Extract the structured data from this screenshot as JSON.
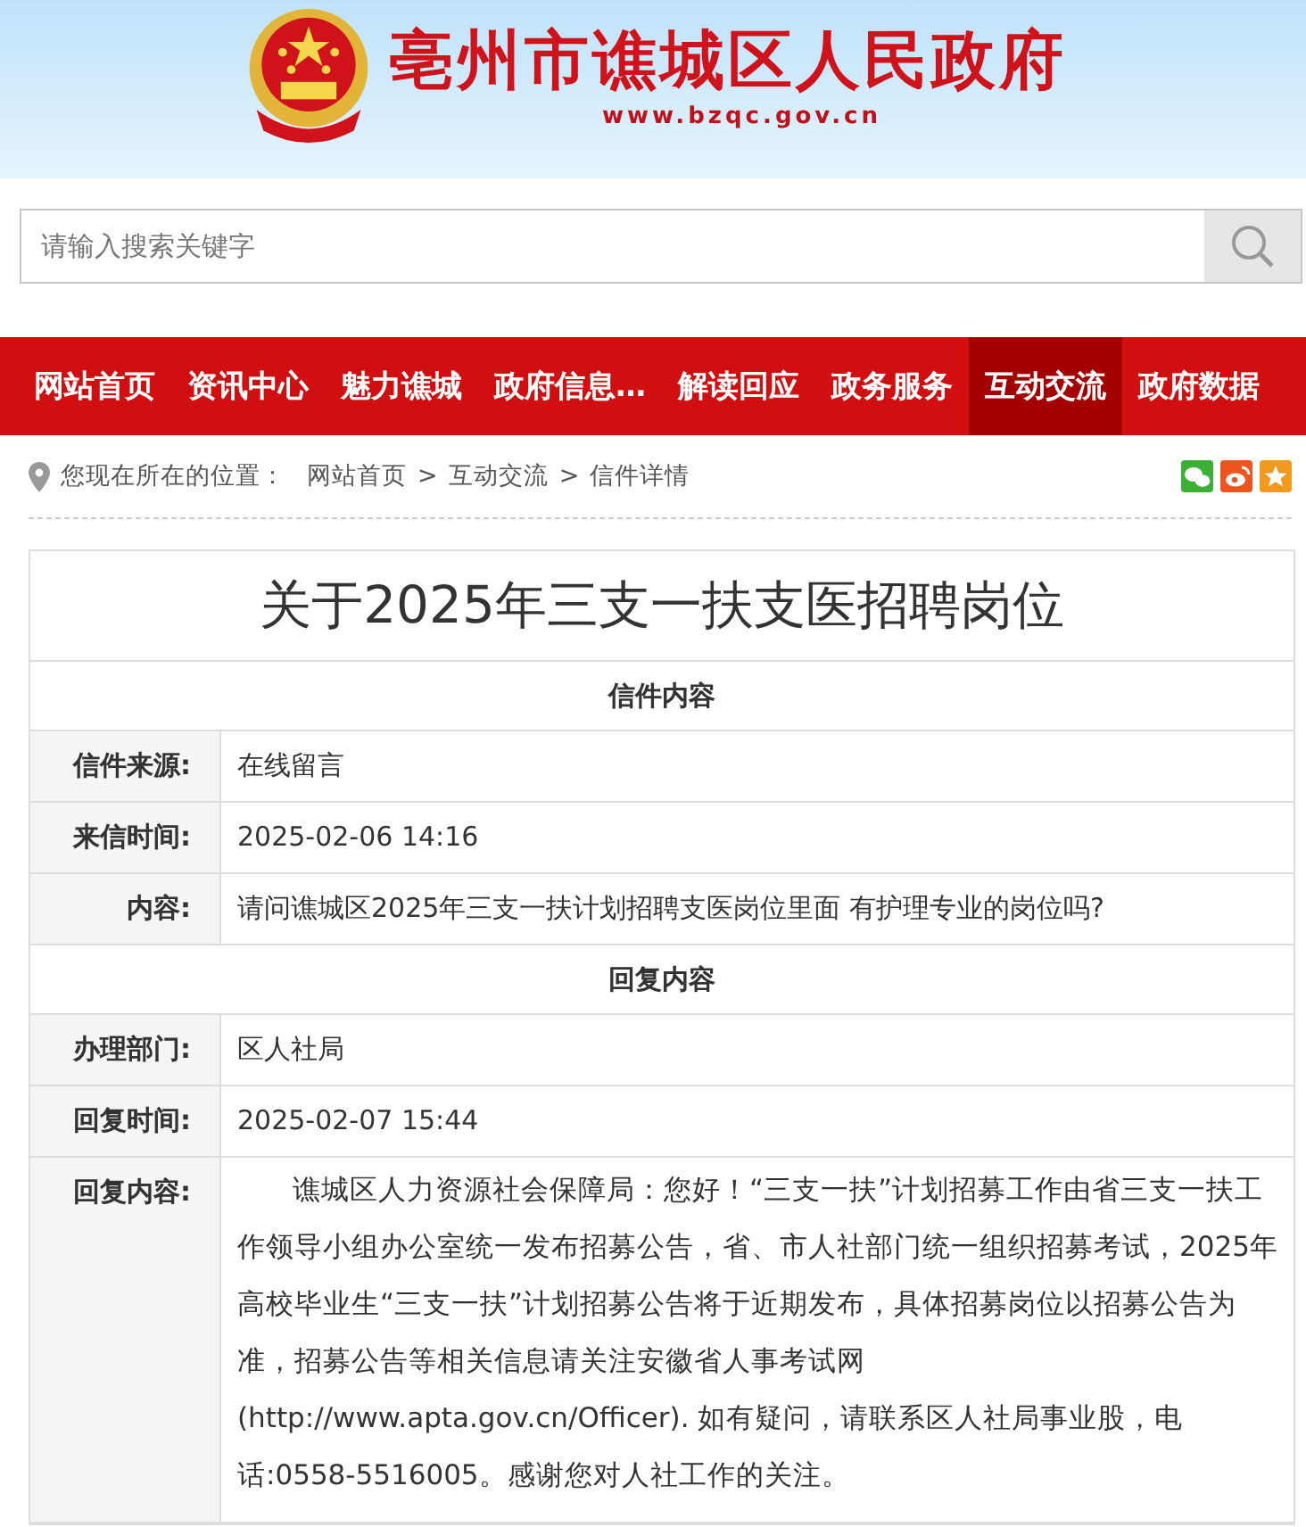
{
  "header": {
    "site_title": "亳州市谯城区人民政府",
    "site_url": "www.bzqc.gov.cn"
  },
  "search": {
    "placeholder": "请输入搜索关键字"
  },
  "nav": [
    {
      "label": "网站首页",
      "selected": false
    },
    {
      "label": "资讯中心",
      "selected": false
    },
    {
      "label": "魅力谯城",
      "selected": false
    },
    {
      "label": "政府信息…",
      "selected": false
    },
    {
      "label": "解读回应",
      "selected": false
    },
    {
      "label": "政务服务",
      "selected": false
    },
    {
      "label": "互动交流",
      "selected": true
    },
    {
      "label": "政府数据",
      "selected": false
    }
  ],
  "breadcrumb": {
    "prefix": "您现在所在的位置：",
    "items": [
      "网站首页",
      "互动交流",
      "信件详情"
    ],
    "separator": ">"
  },
  "share": [
    {
      "kind": "wechat",
      "color": "#3cb034"
    },
    {
      "kind": "weibo",
      "color": "#f0541e"
    },
    {
      "kind": "favorite",
      "color": "#f39a1e"
    }
  ],
  "letter": {
    "title": "关于2025年三支一扶支医招聘岗位",
    "rows": [
      {
        "kind": "section",
        "text": "信件内容"
      },
      {
        "kind": "field",
        "label": "信件来源:",
        "value": "在线留言"
      },
      {
        "kind": "field",
        "label": "来信时间:",
        "value": "2025-02-06 14:16"
      },
      {
        "kind": "field",
        "label": "内容:",
        "value": "请问谯城区2025年三支一扶计划招聘支医岗位里面 有护理专业的岗位吗?"
      },
      {
        "kind": "section",
        "text": "回复内容"
      },
      {
        "kind": "field",
        "label": "办理部门:",
        "value": "区人社局"
      },
      {
        "kind": "field",
        "label": "回复时间:",
        "value": "2025-02-07 15:44"
      },
      {
        "kind": "paragraph",
        "label": "回复内容:",
        "value": "谯城区人力资源社会保障局：您好！“三支一扶”计划招募工作由省三支一扶工作领导小组办公室统一发布招募公告，省、市人社部门统一组织招募考试，2025年高校毕业生“三支一扶”计划招募公告将于近期发布，具体招募岗位以招募公告为准，招募公告等相关信息请关注安徽省人事考试网(http://www.apta.gov.cn/Officer). 如有疑问，请联系区人社局事业股，电话:0558-5516005。感谢您对人社工作的关注。"
      }
    ]
  }
}
